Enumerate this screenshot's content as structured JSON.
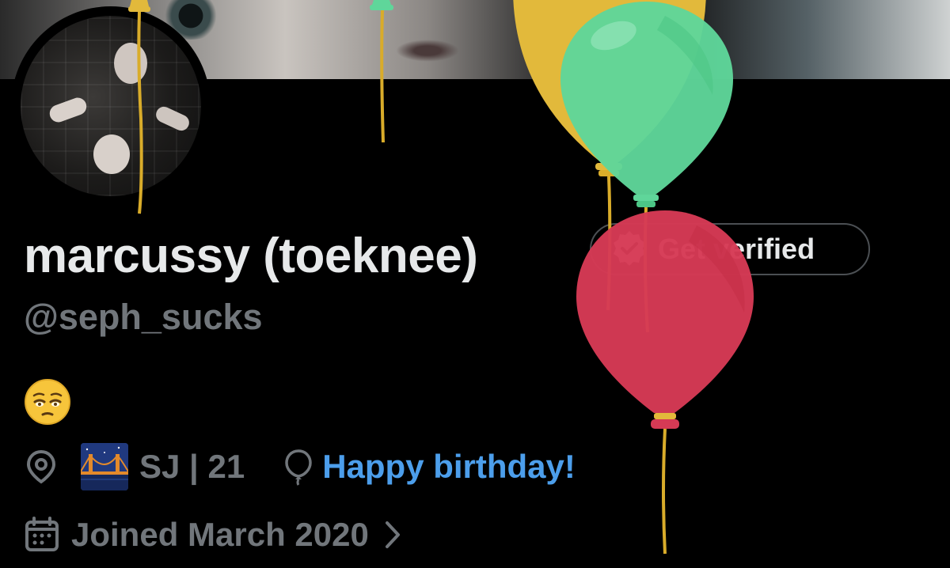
{
  "profile": {
    "display_name": "marcussy (toeknee)",
    "handle": "@seph_sucks",
    "bio_emoji": "pleading-face-emoji",
    "location": "SJ | 21",
    "location_emoji": "bridge-at-night-emoji",
    "birthday_text": "Happy birthday!",
    "joined": "Joined March 2020"
  },
  "verify_button": {
    "label": "Get verified"
  },
  "colors": {
    "background": "#000000",
    "primary_text": "#e7e9ea",
    "secondary_text": "#71767b",
    "link": "#4c9eeb",
    "balloon_yellow": "#e2b93b",
    "balloon_green": "#5fd69a",
    "balloon_red": "#d63a55"
  },
  "icons": {
    "location": "map-pin-icon",
    "birthday": "balloon-icon",
    "joined": "calendar-icon",
    "chevron": "chevron-right-icon",
    "verify": "verified-check-icon"
  }
}
